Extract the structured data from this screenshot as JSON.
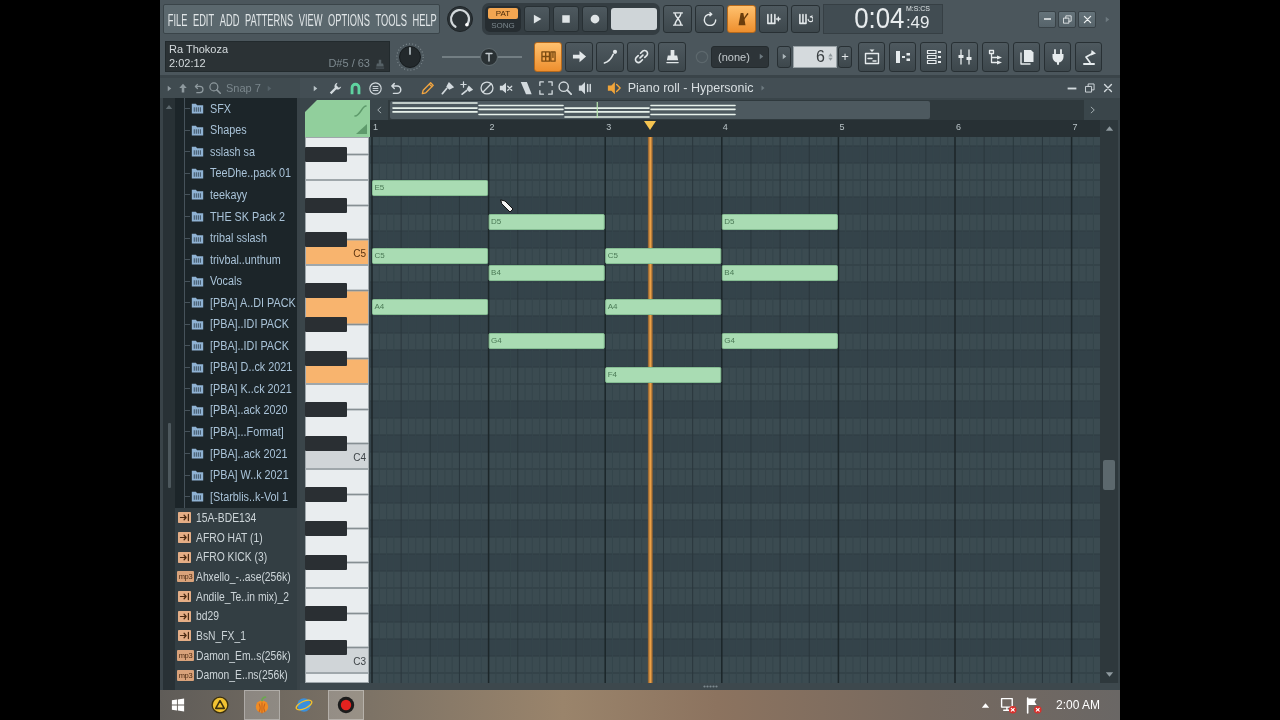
{
  "toolbar": {
    "menu": [
      "FILE",
      "EDIT",
      "ADD",
      "PATTERNS",
      "VIEW",
      "OPTIONS",
      "TOOLS",
      "HELP"
    ],
    "mode": [
      {
        "label": "PAT",
        "selected": true
      },
      {
        "label": "SONG",
        "selected": false
      }
    ],
    "transport": [
      {
        "kind": "play"
      },
      {
        "kind": "stop"
      },
      {
        "kind": "record"
      },
      {
        "kind": "tempo"
      }
    ],
    "toggles": [
      {
        "kind": "hourglass",
        "on": false
      },
      {
        "kind": "countdown",
        "on": false
      },
      {
        "kind": "metronome",
        "on": true
      },
      {
        "kind": "step-add",
        "on": false
      },
      {
        "kind": "step-loop",
        "on": false
      }
    ],
    "time": {
      "value": "0:04",
      "sub": ":49",
      "unit": "M:S:CS"
    },
    "window_buttons": [
      {
        "kind": "minimize"
      },
      {
        "kind": "maximize"
      },
      {
        "kind": "close"
      }
    ]
  },
  "hint_bar": {
    "title": "Ra Thokoza",
    "time": "2:02:12",
    "detail": "D#5 / 63"
  },
  "controls": {
    "pitch_slider": {
      "level": 0.62
    },
    "tools": [
      {
        "kind": "typing-keyboard",
        "on": true
      },
      {
        "kind": "arrow",
        "on": false
      },
      {
        "kind": "pen-stroke",
        "on": false
      },
      {
        "kind": "link",
        "on": false
      },
      {
        "kind": "stamp",
        "on": false
      }
    ],
    "pattern_selector": {
      "value": "(none)"
    },
    "pattern_number": {
      "value": "6"
    },
    "add_pattern": {
      "label": "+"
    },
    "windows": [
      {
        "kind": "playlist"
      },
      {
        "kind": "piano-roll"
      },
      {
        "kind": "channel-rack"
      },
      {
        "kind": "mixer"
      },
      {
        "kind": "browser"
      },
      {
        "kind": "pages"
      },
      {
        "kind": "plugin"
      },
      {
        "kind": "performer"
      }
    ]
  },
  "browser": {
    "header": "Snap 7",
    "folder_contents": [
      "SFX",
      "Shapes",
      "sslash sa",
      "TeeDhe..pack 01",
      "teekayy",
      "THE SK Pack 2",
      "tribal sslash",
      "trivbal..unthum",
      "Vocals",
      "[PBA] A..DI PACK",
      "[PBA]..IDI PACK",
      "[PBA]..IDI PACK",
      "[PBA] D..ck 2021",
      "[PBA] K..ck 2021",
      "[PBA]..ack 2020",
      "[PBA]...Format]",
      "[PBA]..ack 2021",
      "[PBA] W..k 2021",
      "[Starblis..k-Vol 1"
    ],
    "files": [
      {
        "name": "15A-BDE134",
        "kind": "wave"
      },
      {
        "name": "AFRO HAT (1)",
        "kind": "wave"
      },
      {
        "name": "AFRO KICK (3)",
        "kind": "wave"
      },
      {
        "name": "Ahxello_-..ase(256k)",
        "kind": "mp3",
        "badge": "mp3"
      },
      {
        "name": "Andile_Te..in mix)_2",
        "kind": "wave"
      },
      {
        "name": "bd29",
        "kind": "wave"
      },
      {
        "name": "BsN_FX_1",
        "kind": "wave"
      },
      {
        "name": "Damon_Em..s(256k)",
        "kind": "mp3",
        "badge": "mp3"
      },
      {
        "name": "Damon_E..ns(256k)",
        "kind": "mp3",
        "badge": "mp3"
      }
    ]
  },
  "piano_roll": {
    "title": "Piano roll - Hypersonic",
    "snap": {
      "on": true
    },
    "tools": [
      {
        "kind": "pencil",
        "selected": true
      },
      {
        "kind": "brush",
        "selected": false
      },
      {
        "kind": "brush-plus",
        "selected": false
      },
      {
        "kind": "delete",
        "selected": false
      },
      {
        "kind": "mute",
        "selected": false
      },
      {
        "kind": "slice",
        "selected": false
      },
      {
        "kind": "select",
        "selected": false
      },
      {
        "kind": "zoom",
        "selected": false
      },
      {
        "kind": "playback",
        "selected": false
      }
    ],
    "window_buttons": [
      {
        "kind": "minimize"
      },
      {
        "kind": "maximize"
      },
      {
        "kind": "close"
      }
    ],
    "bars": [
      "1",
      "2",
      "3",
      "4",
      "5",
      "6",
      "7"
    ],
    "playhead": {
      "level": 0.384
    },
    "rows": [
      {
        "kind": "white",
        "pressed": false
      },
      {
        "kind": "black"
      },
      {
        "kind": "white",
        "pressed": false
      },
      {
        "kind": "white",
        "pressed": false,
        "steps": [
          {
            "on": true,
            "label": "E5"
          },
          {
            "on": false
          },
          {
            "on": false
          },
          {
            "on": false
          }
        ]
      },
      {
        "kind": "black"
      },
      {
        "kind": "white",
        "pressed": false,
        "steps": [
          {
            "on": false
          },
          {
            "on": true,
            "label": "D5"
          },
          {
            "on": false
          },
          {
            "on": true,
            "label": "D5"
          }
        ]
      },
      {
        "kind": "black"
      },
      {
        "kind": "white",
        "label": "C5",
        "pressed": true,
        "steps": [
          {
            "on": true,
            "label": "C5"
          },
          {
            "on": false
          },
          {
            "on": true,
            "label": "C5"
          },
          {
            "on": false
          }
        ]
      },
      {
        "kind": "white",
        "pressed": false,
        "steps": [
          {
            "on": false
          },
          {
            "on": true,
            "label": "B4"
          },
          {
            "on": false
          },
          {
            "on": true,
            "label": "B4"
          }
        ]
      },
      {
        "kind": "black"
      },
      {
        "kind": "white",
        "pressed": true,
        "steps": [
          {
            "on": true,
            "label": "A4"
          },
          {
            "on": false
          },
          {
            "on": true,
            "label": "A4"
          },
          {
            "on": false
          }
        ]
      },
      {
        "kind": "black"
      },
      {
        "kind": "white",
        "pressed": false,
        "steps": [
          {
            "on": false
          },
          {
            "on": true,
            "label": "G4"
          },
          {
            "on": false
          },
          {
            "on": true,
            "label": "G4"
          }
        ]
      },
      {
        "kind": "black"
      },
      {
        "kind": "white",
        "pressed": true,
        "steps": [
          {
            "on": false
          },
          {
            "on": false
          },
          {
            "on": true,
            "label": "F4"
          },
          {
            "on": false
          }
        ]
      },
      {
        "kind": "white",
        "pressed": false
      },
      {
        "kind": "black"
      },
      {
        "kind": "white",
        "pressed": false
      },
      {
        "kind": "black"
      },
      {
        "kind": "white",
        "label": "C4",
        "pressed": false
      },
      {
        "kind": "white",
        "pressed": false
      },
      {
        "kind": "black"
      },
      {
        "kind": "white",
        "pressed": false
      },
      {
        "kind": "black"
      },
      {
        "kind": "white",
        "pressed": false
      },
      {
        "kind": "black"
      },
      {
        "kind": "white",
        "pressed": false
      },
      {
        "kind": "white",
        "pressed": false
      },
      {
        "kind": "black"
      },
      {
        "kind": "white",
        "pressed": false
      },
      {
        "kind": "black"
      },
      {
        "kind": "white",
        "label": "C3",
        "pressed": false
      },
      {
        "kind": "white",
        "pressed": false
      }
    ]
  },
  "taskbar": {
    "apps": [
      {
        "kind": "triangle-circle",
        "active": false
      },
      {
        "kind": "fruit",
        "active": true
      },
      {
        "kind": "globe",
        "active": false
      },
      {
        "kind": "record-dot",
        "active": true
      }
    ],
    "clock": "2:00 AM"
  }
}
